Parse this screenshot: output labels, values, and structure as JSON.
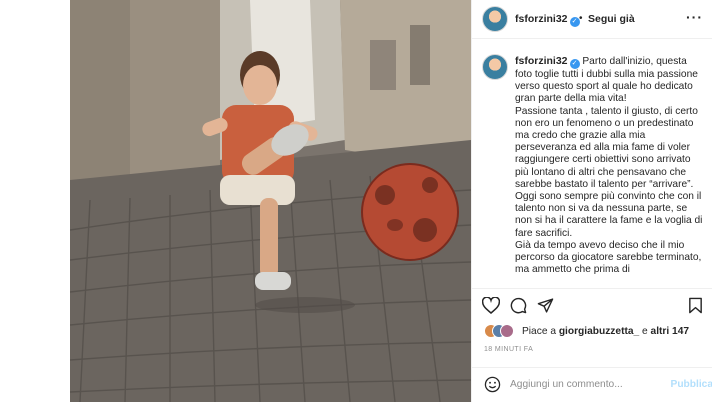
{
  "post": {
    "username": "fsforzini32",
    "verified_glyph": "✓",
    "separator": "•",
    "follow_label": "Segui già",
    "more_label": "···",
    "caption_username": "fsforzini32",
    "caption_lines": [
      "Parto dall'inizio, questa foto toglie tutti i dubbi sulla mia passione verso questo sport al quale ho dedicato gran parte della mia vita!",
      "Passione tanta , talento il giusto, di certo non ero un fenomeno o un predestinato ma credo che grazie alla mia perseveranza ed alla mia fame di voler raggiungere certi obiettivi sono arrivato più lontano di altri che pensavano che sarebbe bastato il talento per “arrivare”.",
      "Oggi sono sempre più convinto che con il talento non si va da nessuna parte, se non si ha il carattere la fame e la voglia di fare sacrifici.",
      "Già da tempo avevo deciso che il mio percorso da giocatore sarebbe terminato, ma ammetto che prima di"
    ],
    "likes_prefix": "Piace a ",
    "likes_user": "giorgiabuzzetta_",
    "likes_mid": " e ",
    "likes_others": "altri 147",
    "time_ago": "18 MINUTI FA",
    "comment_placeholder": "Aggiungi un commento...",
    "publish_label": "Pubblica"
  },
  "icons": {
    "like": "heart-icon",
    "comment": "comment-icon",
    "share": "share-icon",
    "save": "bookmark-icon",
    "emoji": "emoji-icon",
    "more": "more-icon"
  },
  "colors": {
    "verified": "#3897f0",
    "publish_disabled": "#b2dffc",
    "border": "#efefef",
    "muted_text": "#8e8e8e"
  }
}
